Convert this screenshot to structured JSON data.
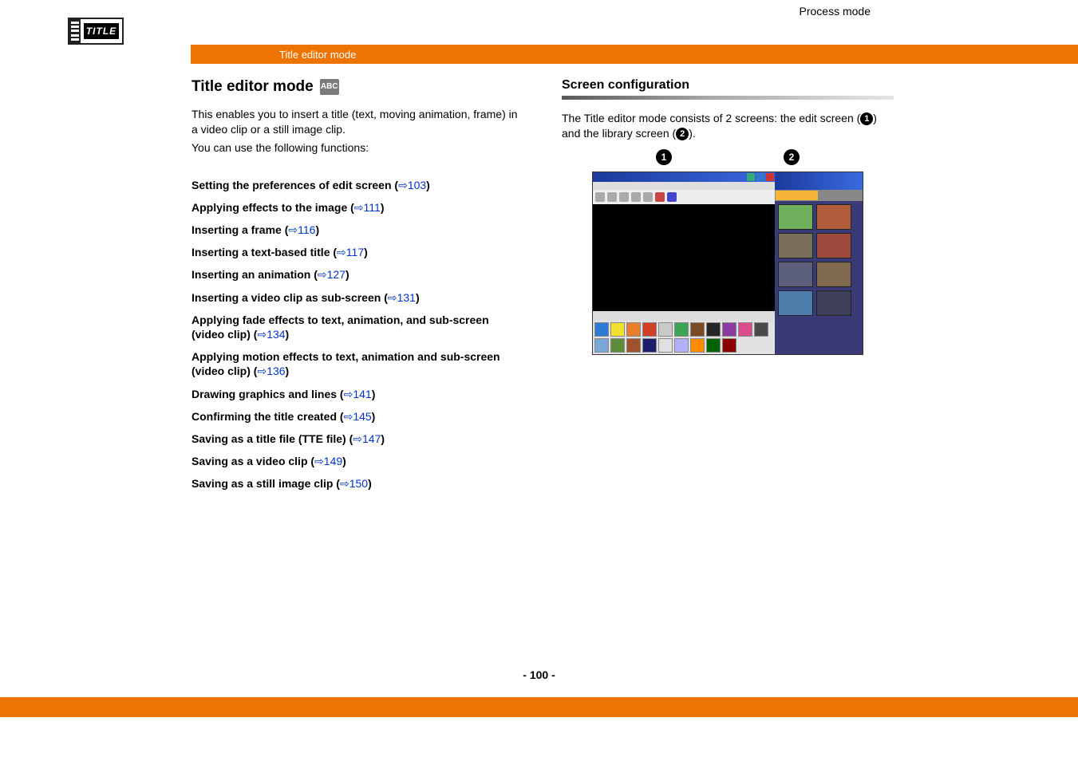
{
  "header": {
    "logo_text": "TITLE",
    "process_mode": "Process mode",
    "breadcrumb": "Title editor mode"
  },
  "left": {
    "title": "Title editor mode",
    "abc_label": "ABC",
    "para1": "This enables you to insert a title (text, moving animation, frame) in a video clip or a still image clip.",
    "para2": "You can use the following functions:",
    "links": [
      {
        "text": "Setting the preferences of edit screen (",
        "page": "103",
        "suffix": ")"
      },
      {
        "text": "Applying effects to the image (",
        "page": "111",
        "suffix": ")"
      },
      {
        "text": "Inserting a frame (",
        "page": "116",
        "suffix": ")"
      },
      {
        "text": "Inserting a text-based title (",
        "page": "117",
        "suffix": ")"
      },
      {
        "text": "Inserting an animation (",
        "page": "127",
        "suffix": ")"
      },
      {
        "text": "Inserting a video clip as sub-screen (",
        "page": "131",
        "suffix": ")"
      },
      {
        "text": "Applying fade effects to text, animation, and sub-screen (video clip) (",
        "page": "134",
        "suffix": ")"
      },
      {
        "text": "Applying motion effects to text, animation and sub-screen (video clip) (",
        "page": "136",
        "suffix": ")"
      },
      {
        "text": "Drawing graphics and lines (",
        "page": "141",
        "suffix": ")"
      },
      {
        "text": "Confirming the title created (",
        "page": "145",
        "suffix": ")"
      },
      {
        "text": "Saving as a title file (TTE file) (",
        "page": "147",
        "suffix": ")"
      },
      {
        "text": "Saving as a video clip (",
        "page": "149",
        "suffix": ")"
      },
      {
        "text": "Saving as a still image clip (",
        "page": "150",
        "suffix": ")"
      }
    ]
  },
  "right": {
    "section_title": "Screen configuration",
    "desc_pre": "The Title editor mode consists of 2 screens: the edit screen (",
    "desc_mid": ") and the library screen (",
    "desc_post": ").",
    "callout1": "1",
    "callout2": "2"
  },
  "palette_colors": [
    "#2e7bd6",
    "#f2e030",
    "#e77f2b",
    "#d04028",
    "#c9c9c9",
    "#3aa655",
    "#7b4b25",
    "#262626",
    "#8a3d9e",
    "#d94c8e",
    "#4a4a4a",
    "#7aa7d8",
    "#5e8c3a",
    "#a0522d",
    "#1e1e6e",
    "#e0e0e0",
    "#b0b0ff",
    "#ff8c00",
    "#006400",
    "#8b0000"
  ],
  "thumb_colors": [
    "#6fae5b",
    "#b15c3a",
    "#7a6f58",
    "#9c4a3b",
    "#5b5f7a",
    "#7f6a4f",
    "#4c7ca8",
    "#3f3f5a"
  ],
  "footer": {
    "page": "- 100 -"
  }
}
